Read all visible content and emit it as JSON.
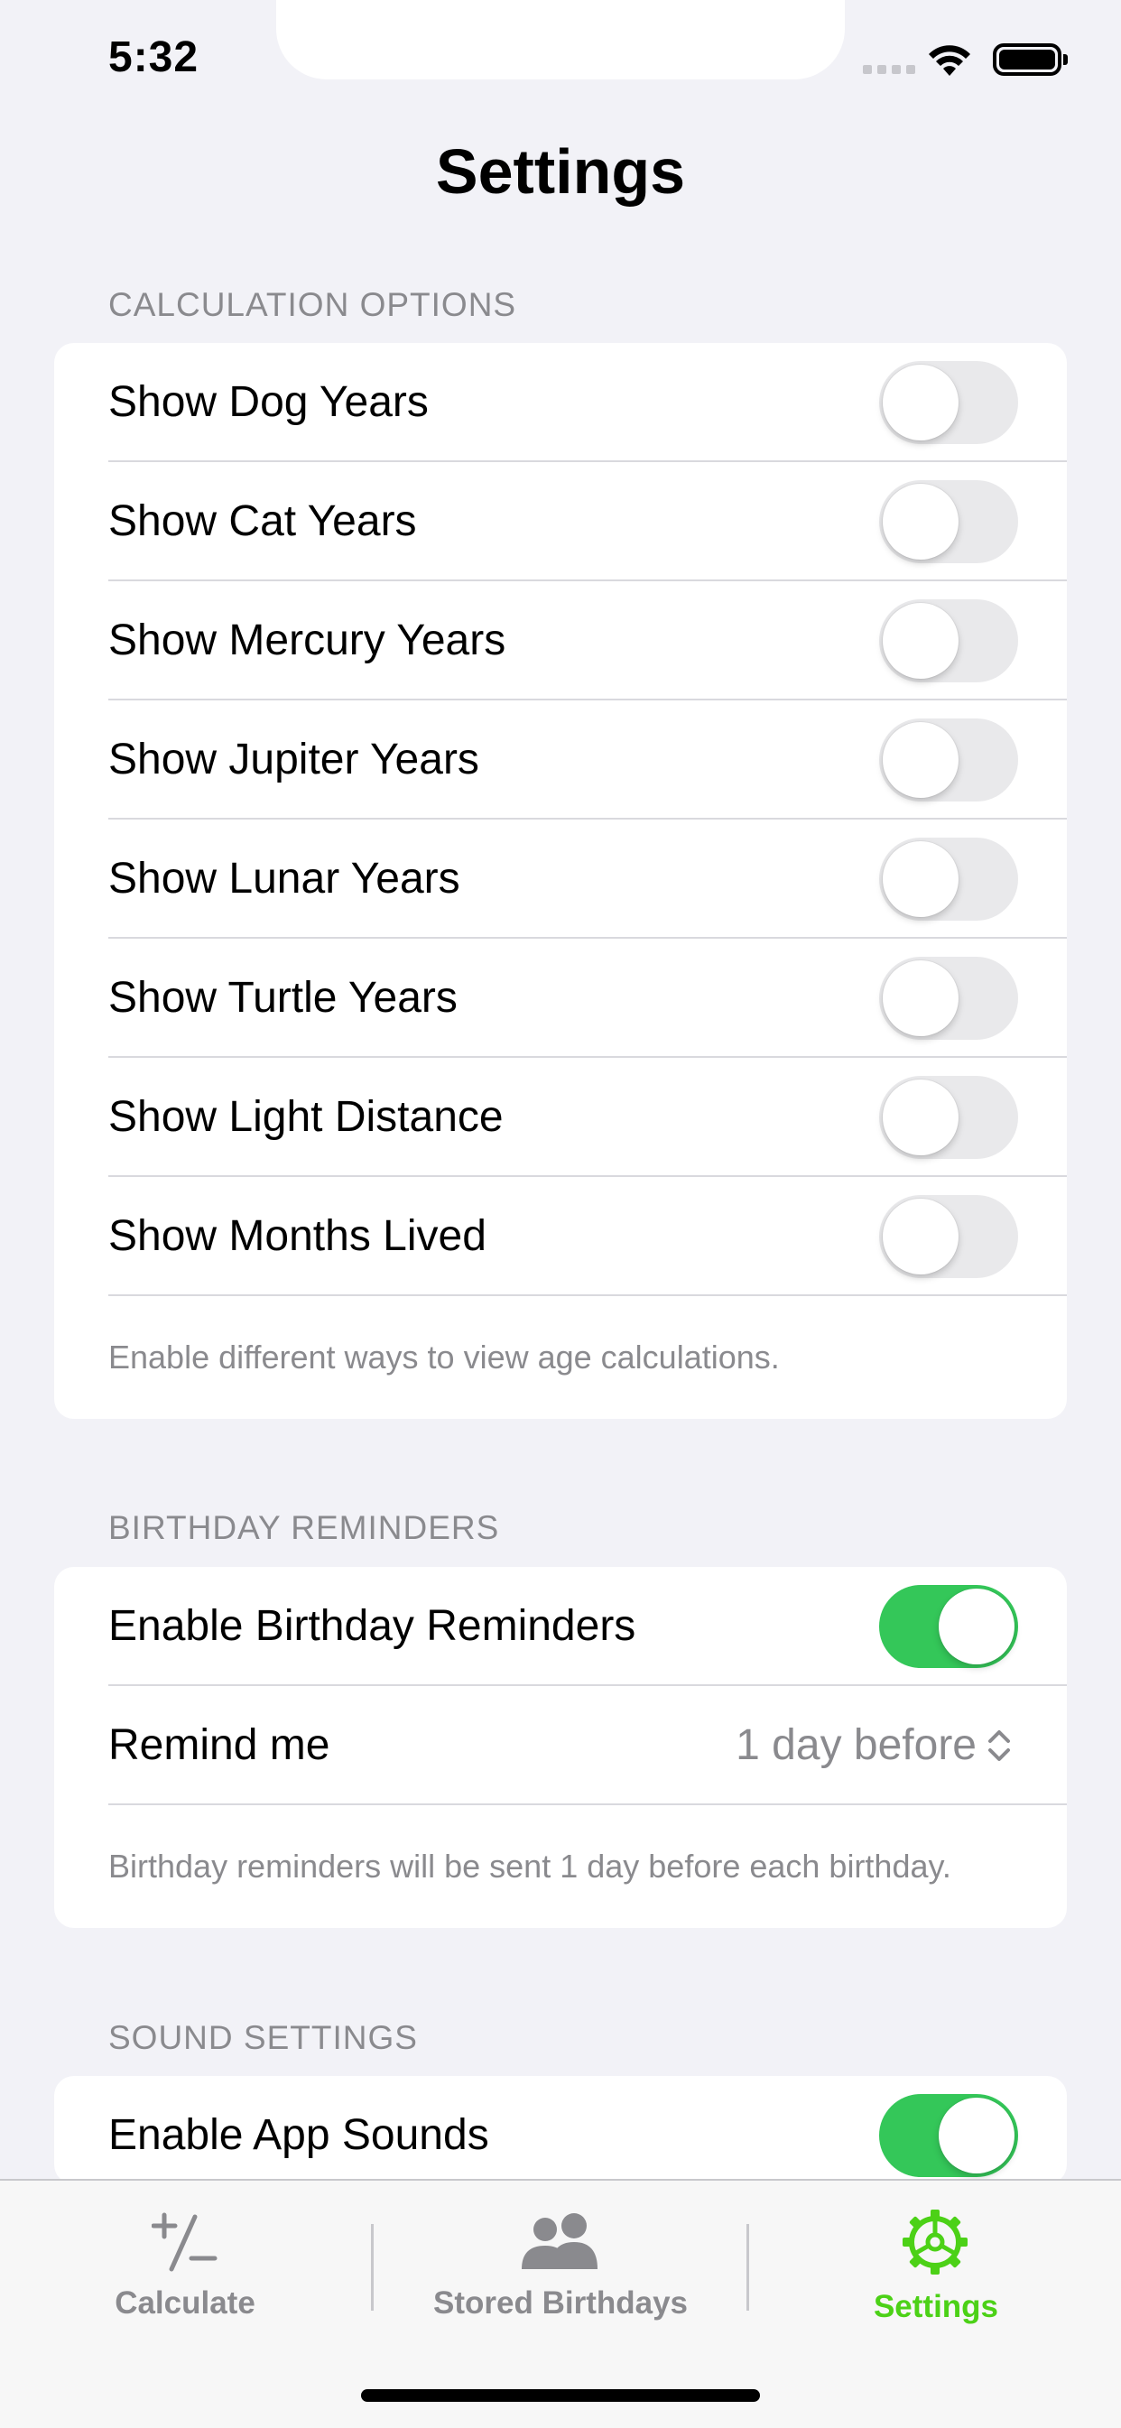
{
  "status_bar": {
    "time": "5:32"
  },
  "page_title": "Settings",
  "calculation_options": {
    "header": "CALCULATION OPTIONS",
    "items": [
      {
        "label": "Show Dog Years",
        "enabled": false
      },
      {
        "label": "Show Cat Years",
        "enabled": false
      },
      {
        "label": "Show Mercury Years",
        "enabled": false
      },
      {
        "label": "Show Jupiter Years",
        "enabled": false
      },
      {
        "label": "Show Lunar Years",
        "enabled": false
      },
      {
        "label": "Show Turtle Years",
        "enabled": false
      },
      {
        "label": "Show Light Distance",
        "enabled": false
      },
      {
        "label": "Show Months Lived",
        "enabled": false
      }
    ],
    "footer": "Enable different ways to view age calculations."
  },
  "birthday_reminders": {
    "header": "BIRTHDAY REMINDERS",
    "enable_label": "Enable Birthday Reminders",
    "enable_on": true,
    "remind_label": "Remind me",
    "remind_value": "1 day before",
    "footer": "Birthday reminders will be sent 1 day before each birthday."
  },
  "sound_settings": {
    "header": "SOUND SETTINGS",
    "enable_label": "Enable App Sounds",
    "enable_on": true
  },
  "tab_bar": {
    "tabs": [
      {
        "label": "Calculate",
        "icon": "plus-minus-icon",
        "selected": false
      },
      {
        "label": "Stored Birthdays",
        "icon": "people-icon",
        "selected": false
      },
      {
        "label": "Settings",
        "icon": "gear-icon",
        "selected": true
      }
    ]
  },
  "colors": {
    "accent": "#4cd117",
    "toggle_on": "#34c759",
    "secondary_text": "#8a8a8e"
  }
}
